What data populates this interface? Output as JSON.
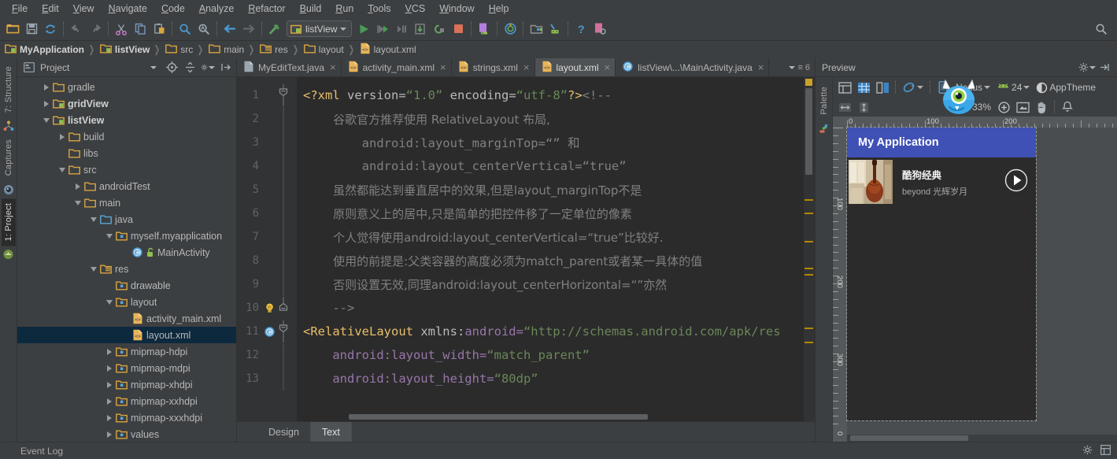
{
  "menubar": {
    "items": [
      "File",
      "Edit",
      "View",
      "Navigate",
      "Code",
      "Analyze",
      "Refactor",
      "Build",
      "Run",
      "Tools",
      "VCS",
      "Window",
      "Help"
    ]
  },
  "toolbar": {
    "icons": [
      "open-folder-icon",
      "save-all-icon",
      "sync-icon",
      "undo-icon",
      "redo-icon",
      "cut-icon",
      "copy-icon",
      "paste-icon",
      "find-icon",
      "replace-icon",
      "back-icon",
      "forward-icon",
      "build-hammer-icon"
    ],
    "run_config": "listView",
    "right_icons": [
      "run-icon",
      "debug-icon",
      "run-step-icon",
      "install-icon",
      "restart-icon",
      "stop-icon",
      "avd-manager-icon",
      "sync-gradle-icon",
      "sdk-manager-icon",
      "android-device-monitor-icon",
      "help-icon",
      "layout-inspector-icon"
    ],
    "search_icon": "search-everywhere-icon"
  },
  "breadcrumb": {
    "items": [
      {
        "label": "MyApplication",
        "icon": "module-icon",
        "bold": true
      },
      {
        "label": "listView",
        "icon": "module-icon",
        "bold": true
      },
      {
        "label": "src",
        "icon": "folder-icon",
        "bold": false
      },
      {
        "label": "main",
        "icon": "folder-icon",
        "bold": false
      },
      {
        "label": "res",
        "icon": "res-folder-icon",
        "bold": false
      },
      {
        "label": "layout",
        "icon": "folder-icon",
        "bold": false
      },
      {
        "label": "layout.xml",
        "icon": "xml-file-icon",
        "bold": false
      }
    ]
  },
  "left_strip": {
    "tabs": [
      {
        "label": "7: Structure",
        "icon": "structure-icon",
        "active": false
      },
      {
        "label": "Captures",
        "icon": "captures-icon",
        "active": false
      },
      {
        "label": "1: Project",
        "icon": "android-icon",
        "active": true
      }
    ]
  },
  "project_panel": {
    "title": "Project",
    "header_icons": [
      "target-icon",
      "collapse-all-icon",
      "gear-icon",
      "hide-icon"
    ],
    "tree": [
      {
        "label": "gradle",
        "indent": 1,
        "icon": "folder-icon",
        "twist": "right",
        "bold": false,
        "selected": false
      },
      {
        "label": "gridView",
        "indent": 1,
        "icon": "module-icon",
        "twist": "right",
        "bold": true,
        "selected": false
      },
      {
        "label": "listView",
        "indent": 1,
        "icon": "module-icon",
        "twist": "down",
        "bold": true,
        "selected": false
      },
      {
        "label": "build",
        "indent": 2,
        "icon": "folder-icon",
        "twist": "right",
        "bold": false,
        "selected": false
      },
      {
        "label": "libs",
        "indent": 2,
        "icon": "folder-icon",
        "twist": "none",
        "bold": false,
        "selected": false
      },
      {
        "label": "src",
        "indent": 2,
        "icon": "folder-icon",
        "twist": "down",
        "bold": false,
        "selected": false
      },
      {
        "label": "androidTest",
        "indent": 3,
        "icon": "folder-icon",
        "twist": "right",
        "bold": false,
        "selected": false
      },
      {
        "label": "main",
        "indent": 3,
        "icon": "folder-icon",
        "twist": "down",
        "bold": false,
        "selected": false
      },
      {
        "label": "java",
        "indent": 4,
        "icon": "java-folder-icon",
        "twist": "down",
        "bold": false,
        "selected": false
      },
      {
        "label": "myself.myapplication",
        "indent": 5,
        "icon": "package-icon",
        "twist": "down",
        "bold": false,
        "selected": false
      },
      {
        "label": "MainActivity",
        "indent": 6,
        "icon": "class-icon",
        "twist": "none",
        "bold": false,
        "selected": false,
        "badge": "unlock-icon"
      },
      {
        "label": "res",
        "indent": 4,
        "icon": "res-folder-icon",
        "twist": "down",
        "bold": false,
        "selected": false
      },
      {
        "label": "drawable",
        "indent": 5,
        "icon": "package-icon",
        "twist": "none",
        "bold": false,
        "selected": false
      },
      {
        "label": "layout",
        "indent": 5,
        "icon": "package-icon",
        "twist": "down",
        "bold": false,
        "selected": false
      },
      {
        "label": "activity_main.xml",
        "indent": 6,
        "icon": "xml-file-icon",
        "twist": "none",
        "bold": false,
        "selected": false
      },
      {
        "label": "layout.xml",
        "indent": 6,
        "icon": "xml-file-icon",
        "twist": "none",
        "bold": false,
        "selected": true
      },
      {
        "label": "mipmap-hdpi",
        "indent": 5,
        "icon": "package-icon",
        "twist": "right",
        "bold": false,
        "selected": false
      },
      {
        "label": "mipmap-mdpi",
        "indent": 5,
        "icon": "package-icon",
        "twist": "right",
        "bold": false,
        "selected": false
      },
      {
        "label": "mipmap-xhdpi",
        "indent": 5,
        "icon": "package-icon",
        "twist": "right",
        "bold": false,
        "selected": false
      },
      {
        "label": "mipmap-xxhdpi",
        "indent": 5,
        "icon": "package-icon",
        "twist": "right",
        "bold": false,
        "selected": false
      },
      {
        "label": "mipmap-xxxhdpi",
        "indent": 5,
        "icon": "package-icon",
        "twist": "right",
        "bold": false,
        "selected": false
      },
      {
        "label": "values",
        "indent": 5,
        "icon": "package-icon",
        "twist": "right",
        "bold": false,
        "selected": false
      }
    ]
  },
  "editor": {
    "tabs": [
      {
        "label": "MyEditText.java",
        "icon": "java-file-icon",
        "active": false,
        "closable": true
      },
      {
        "label": "activity_main.xml",
        "icon": "xml-file-icon",
        "active": false,
        "closable": true
      },
      {
        "label": "strings.xml",
        "icon": "xml-file-icon",
        "active": false,
        "closable": true
      },
      {
        "label": "layout.xml",
        "icon": "xml-file-icon",
        "active": true,
        "closable": true
      },
      {
        "label": "listView\\...\\MainActivity.java",
        "icon": "class-icon",
        "active": false,
        "closable": true
      }
    ],
    "tab_overflow": "6",
    "lines": [
      {
        "num": "1",
        "fold": "start",
        "mark": "",
        "parts": [
          {
            "t": "<?xml ",
            "c": "xmlpi"
          },
          {
            "t": "version=",
            "c": "attr"
          },
          {
            "t": "“1.0”",
            "c": "val"
          },
          {
            "t": " encoding=",
            "c": "attr"
          },
          {
            "t": "“utf-8”",
            "c": "val"
          },
          {
            "t": "?>",
            "c": "xmlpi"
          },
          {
            "t": "<!--",
            "c": "cmt"
          }
        ]
      },
      {
        "num": "2",
        "fold": "",
        "mark": "",
        "parts": [
          {
            "t": "        谷歌官方推荐使用 RelativeLayout 布局,",
            "c": "cmt cmt-zh"
          }
        ]
      },
      {
        "num": "3",
        "fold": "",
        "mark": "",
        "parts": [
          {
            "t": "        android:layout_marginTop=“” 和",
            "c": "cmt"
          }
        ]
      },
      {
        "num": "4",
        "fold": "",
        "mark": "",
        "parts": [
          {
            "t": "        android:layout_centerVertical=“true”",
            "c": "cmt"
          }
        ]
      },
      {
        "num": "5",
        "fold": "",
        "mark": "",
        "parts": [
          {
            "t": "        虽然都能达到垂直居中的效果,但是layout_marginTop不是",
            "c": "cmt cmt-zh"
          }
        ]
      },
      {
        "num": "6",
        "fold": "",
        "mark": "",
        "parts": [
          {
            "t": "        原则意义上的居中,只是简单的把控件移了一定单位的像素",
            "c": "cmt cmt-zh"
          }
        ]
      },
      {
        "num": "7",
        "fold": "",
        "mark": "",
        "parts": [
          {
            "t": "        个人觉得使用android:layout_centerVertical=“true”比较好.",
            "c": "cmt cmt-zh"
          }
        ]
      },
      {
        "num": "8",
        "fold": "",
        "mark": "",
        "parts": [
          {
            "t": "        使用的前提是:父类容器的高度必须为match_parent或者某一具体的值",
            "c": "cmt cmt-zh"
          }
        ]
      },
      {
        "num": "9",
        "fold": "",
        "mark": "",
        "parts": [
          {
            "t": "        否则设置无效,同理android:layout_centerHorizontal=“”亦然",
            "c": "cmt cmt-zh"
          }
        ]
      },
      {
        "num": "10",
        "fold": "end",
        "mark": "bulb-icon",
        "parts": [
          {
            "t": "    -->",
            "c": "cmt"
          }
        ]
      },
      {
        "num": "11",
        "fold": "start",
        "mark": "class-icon",
        "parts": [
          {
            "t": "<RelativeLayout ",
            "c": "tag"
          },
          {
            "t": "xmlns:",
            "c": "attr"
          },
          {
            "t": "android=",
            "c": "ns"
          },
          {
            "t": "“http://schemas.android.com/apk/res",
            "c": "val"
          }
        ]
      },
      {
        "num": "12",
        "fold": "",
        "mark": "",
        "parts": [
          {
            "t": "    android:layout_width=",
            "c": "ns"
          },
          {
            "t": "“match_parent”",
            "c": "val"
          }
        ]
      },
      {
        "num": "13",
        "fold": "",
        "mark": "",
        "parts": [
          {
            "t": "    android:layout_height=",
            "c": "ns"
          },
          {
            "t": "“80dp”",
            "c": "val"
          }
        ]
      }
    ],
    "design_tabs": [
      {
        "label": "Design",
        "active": false
      },
      {
        "label": "Text",
        "active": true
      }
    ]
  },
  "preview": {
    "title": "Preview",
    "header_icons": [
      "gear-icon",
      "hide-panel-icon"
    ],
    "palette_label": "Palette",
    "toolbar": {
      "layout_icons": [
        "design-mode-icon",
        "blueprint-mode-icon",
        "both-mode-icon"
      ],
      "orientation_icon": "rotate-icon",
      "device_icon": "phone-icon",
      "device": "Nexus",
      "api_icon": "android-icon",
      "api_level": "24",
      "theme_icon": "theme-contrast-icon",
      "theme": "AppTheme"
    },
    "toolbar2": {
      "constraint_icons": [
        "horizontal-constraint-icon",
        "vertical-constraint-icon"
      ],
      "zoom_out_icon": "zoom-out-icon",
      "zoom_level": "33%",
      "zoom_in_icon": "zoom-in-icon",
      "zoom_fit_icon": "zoom-fit-icon",
      "pan_icon": "pan-hand-icon",
      "notification_icon": "bell-icon"
    },
    "ruler": {
      "h_labels": [
        "0",
        "100",
        "200"
      ],
      "v_labels": [
        "100",
        "200",
        "300",
        "0"
      ]
    },
    "device_render": {
      "app_bar_title": "My Application",
      "item_title": "酷狗经典",
      "item_subtitle": "beyond 光辉岁月",
      "play_icon": "play-circle-icon",
      "thumb_icon": "album-art-cello"
    }
  },
  "statusbar": {
    "event_log": "Event Log",
    "right_icons": [
      "gear-icon",
      "layout-icon"
    ]
  },
  "cursor": {
    "icon": "monster-magnifier-cursor"
  },
  "colors": {
    "accent_blue": "#3f51b5",
    "selection": "#0d293e",
    "panel_bg": "#3c3f41",
    "editor_bg": "#2b2b2b",
    "tag": "#e8bf6a",
    "value": "#6a8759",
    "namespace": "#9876aa",
    "comment": "#808080",
    "warning_marker": "#b58900"
  }
}
